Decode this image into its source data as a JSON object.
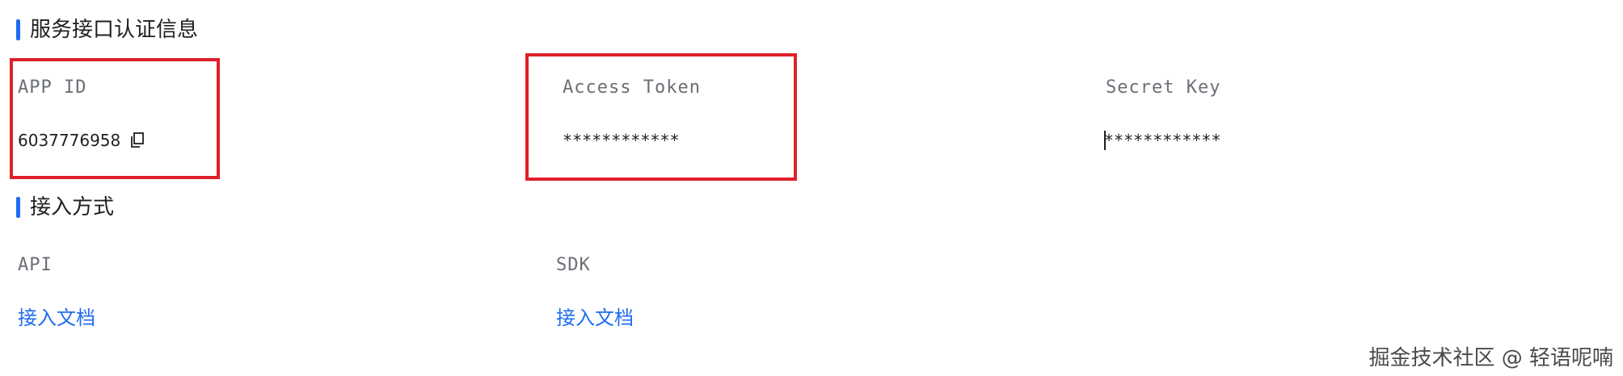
{
  "auth_section": {
    "title": "服务接口认证信息",
    "fields": [
      {
        "label": "APP ID",
        "value": "6037776958"
      },
      {
        "label": "Access Token",
        "value": "************"
      },
      {
        "label": "Secret Key",
        "value": "************"
      }
    ]
  },
  "access_section": {
    "title": "接入方式",
    "methods": [
      {
        "label": "API",
        "link": "接入文档"
      },
      {
        "label": "SDK",
        "link": "接入文档"
      }
    ]
  },
  "watermark": "掘金技术社区 @ 轻语呢喃",
  "colors": {
    "accent": "#1f6cf0",
    "highlight": "#e0202a",
    "label": "#6b6f76"
  },
  "icons": {
    "copy": "copy-icon"
  }
}
